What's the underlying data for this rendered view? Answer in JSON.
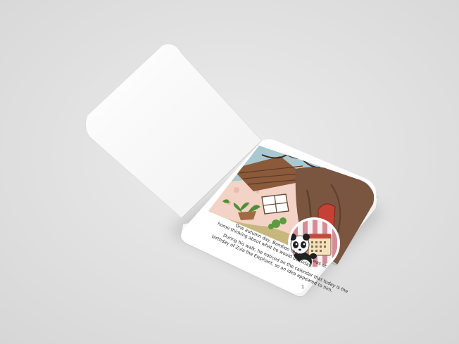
{
  "book": {
    "paragraph_1_line_1": "One autumn day, Bamboo the panda was at",
    "paragraph_1_line_2": "home thinking about what he would do today.",
    "paragraph_2_line_1": "During his walk, he noticed on the calendar that today is the",
    "paragraph_2_line_2": "birthday of Zula the Elephant, so an idea appeared to him.",
    "page_number": "1"
  }
}
